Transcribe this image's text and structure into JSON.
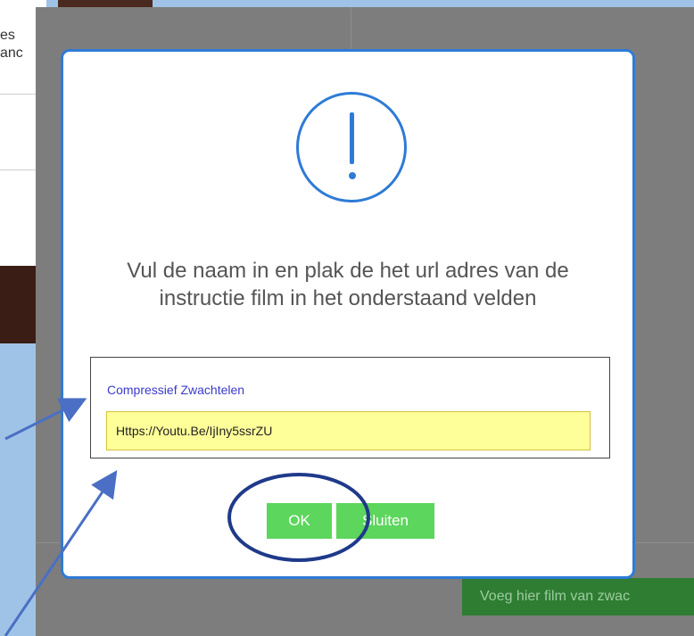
{
  "background": {
    "card_text_lines": [
      "es",
      "anc"
    ],
    "green_button_label": "Voeg hier film van zwac"
  },
  "dialog": {
    "icon": "exclamation-icon",
    "message": "Vul de naam in en plak de het url adres van de instructie film in het onderstaand velden",
    "name_value": "Compressief Zwachtelen",
    "url_value": "Https://Youtu.Be/IjIny5ssrZU",
    "ok_label": "OK",
    "close_label": "Sluiten"
  },
  "colors": {
    "accent": "#2e7bd6",
    "button_green": "#5cd65c",
    "input_highlight": "#ffff99",
    "annotation": "#4a6fc4"
  }
}
